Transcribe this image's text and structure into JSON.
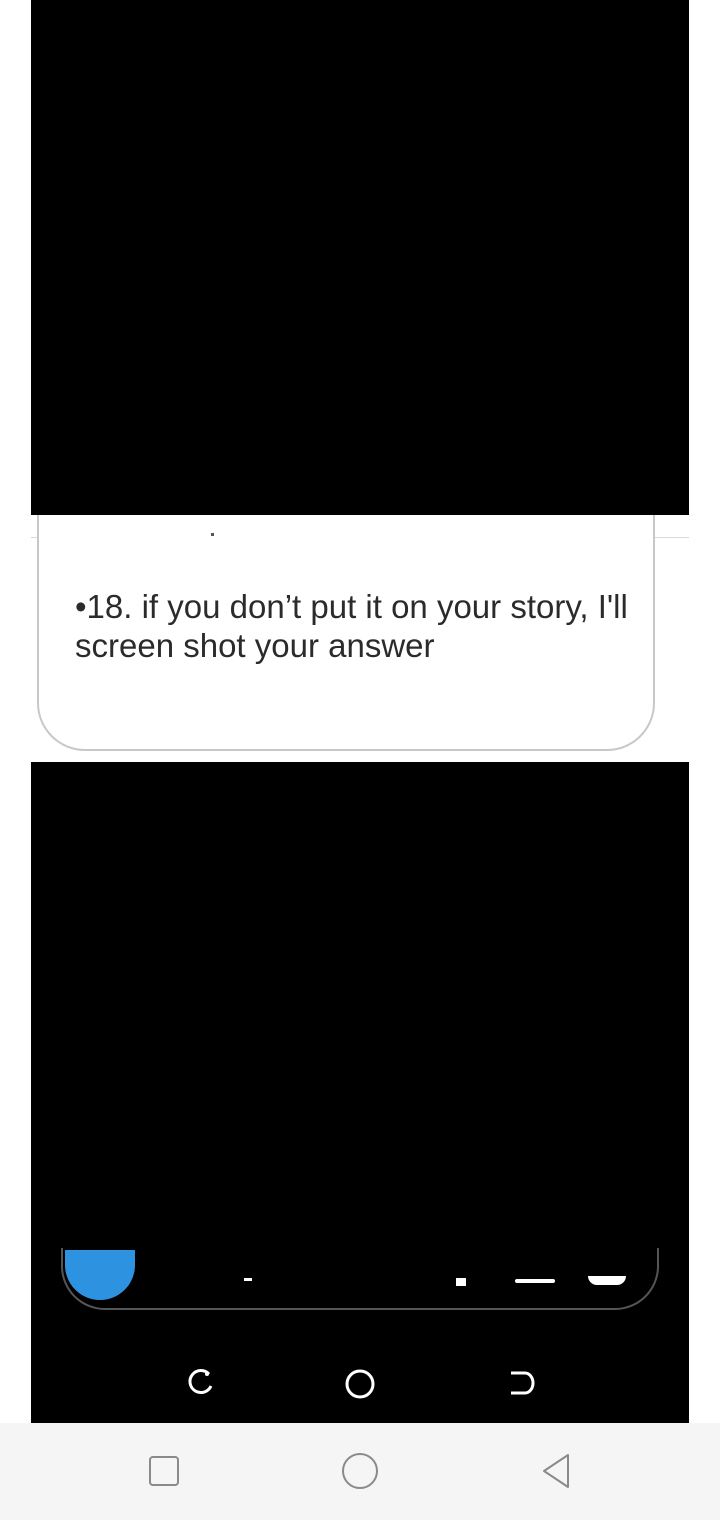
{
  "card": {
    "text": "•18. if you don’t put it on your story, I'll screen shot your answer"
  },
  "system_nav": {
    "recents_icon": "square-icon",
    "home_icon": "circle-icon",
    "back_icon": "triangle-back-icon"
  },
  "inner_nav": {
    "icons": [
      "recent-apps-icon",
      "home-icon",
      "back-icon"
    ]
  }
}
